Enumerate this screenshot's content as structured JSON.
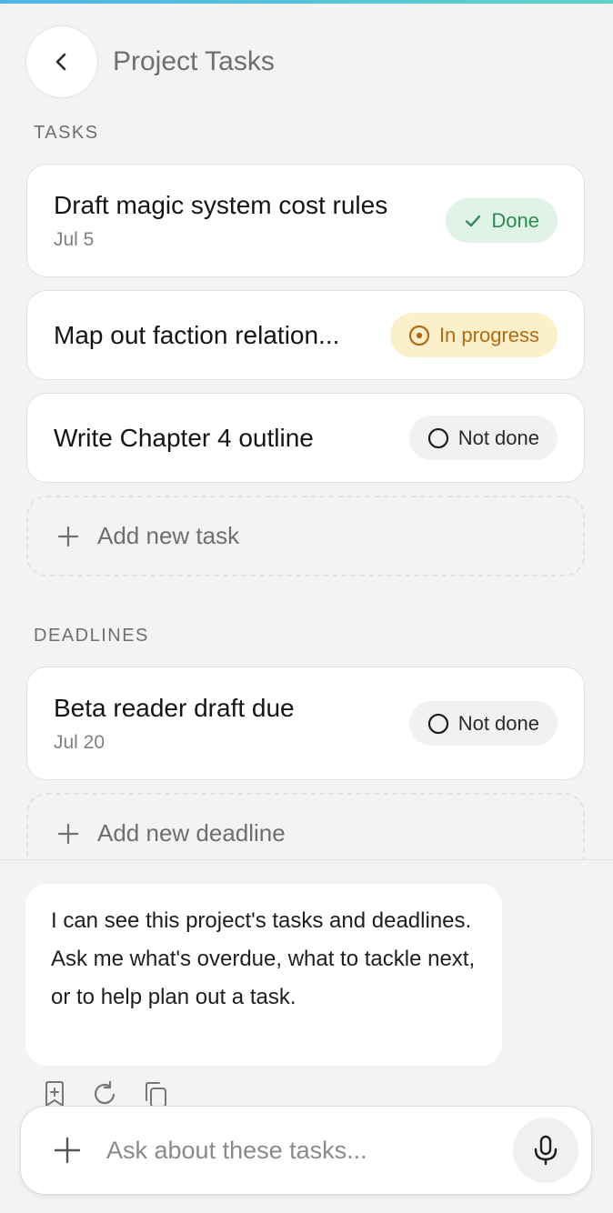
{
  "header": {
    "title": "Project Tasks",
    "back_icon": "chevron-left-icon"
  },
  "tasks_section": {
    "label": "TASKS",
    "items": [
      {
        "title": "Draft magic system cost rules",
        "date": "Jul 5",
        "status": "Done",
        "status_icon": "check-icon"
      },
      {
        "title": "Map out faction relation...",
        "status": "In progress",
        "status_icon": "in-progress-icon"
      },
      {
        "title": "Write Chapter 4 outline",
        "status": "Not done",
        "status_icon": "empty-circle-icon"
      }
    ],
    "add_label": "Add new task"
  },
  "deadlines_section": {
    "label": "DEADLINES",
    "items": [
      {
        "title": "Beta reader draft due",
        "date": "Jul 20",
        "status": "Not done",
        "status_icon": "empty-circle-icon"
      }
    ],
    "add_label": "Add new deadline"
  },
  "chat": {
    "assistant_message": "I can see this project's tasks and deadlines. Ask me what's overdue, what to tackle next, or to help plan out a task.",
    "action_icons": [
      "bookmark-add-icon",
      "refresh-icon",
      "copy-icon"
    ],
    "input_placeholder": "Ask about these tasks...",
    "input_value": ""
  },
  "colors": {
    "background": "#f3f3f3",
    "done_bg": "#dff4e6",
    "done_text": "#2e8a52",
    "progress_bg": "#fbf0c9",
    "progress_text": "#b26a12",
    "notdone_bg": "#f1f1f1",
    "accent_start": "#4fb3e8",
    "accent_end": "#5fd3c8"
  }
}
